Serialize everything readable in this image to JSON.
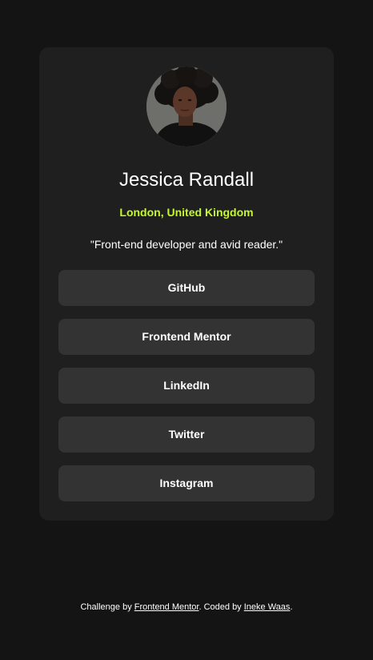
{
  "profile": {
    "name": "Jessica Randall",
    "location": "London, United Kingdom",
    "bio": "\"Front-end developer and avid reader.\""
  },
  "links": [
    {
      "label": "GitHub"
    },
    {
      "label": "Frontend Mentor"
    },
    {
      "label": "LinkedIn"
    },
    {
      "label": "Twitter"
    },
    {
      "label": "Instagram"
    }
  ],
  "footer": {
    "prefix": "Challenge by ",
    "challenge_link": "Frontend Mentor",
    "middle": ". Coded by ",
    "author_link": "Ineke Waas",
    "suffix": "."
  },
  "colors": {
    "background": "#141414",
    "card": "#1f1f1f",
    "button": "#333333",
    "accent": "#c4f82a"
  }
}
